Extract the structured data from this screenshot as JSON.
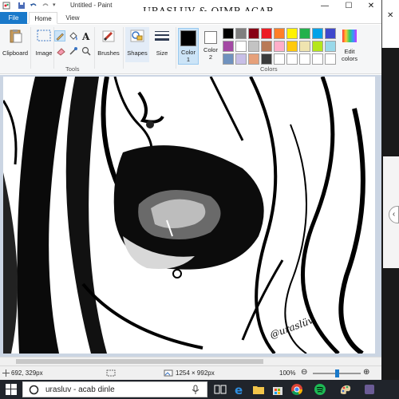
{
  "window": {
    "title": "Untitled - Paint",
    "overlay_caption": "URASLUV & QIMP ACAB",
    "controls": {
      "minimize": "—",
      "maximize": "☐",
      "close": "✕"
    }
  },
  "tabs": {
    "file": "File",
    "home": "Home",
    "view": "View"
  },
  "ribbon": {
    "clipboard": "Clipboard",
    "image": "Image",
    "tools": "Tools",
    "brushes": "Brushes",
    "shapes": "Shapes",
    "size": "Size",
    "color1": "Color\n1",
    "color1_a": "Color",
    "color1_b": "1",
    "color2_a": "Color",
    "color2_b": "2",
    "colors": "Colors",
    "edit_colors_a": "Edit",
    "edit_colors_b": "colors"
  },
  "palette": [
    "#000000",
    "#7f7f7f",
    "#880015",
    "#ed1c24",
    "#ff7f27",
    "#fff200",
    "#22b14c",
    "#00a2e8",
    "#3f48cc",
    "#a349a4",
    "#ffffff",
    "#c3c3c3",
    "#b97a57",
    "#ffaec9",
    "#ffc90e",
    "#efe4b0",
    "#b5e61d",
    "#99d9ea",
    "#7092be",
    "#c8bfe7",
    "#e6a07a",
    "#3b3b3b",
    "#ffffff",
    "#ffffff",
    "#ffffff",
    "#ffffff",
    "#ffffff",
    "#ffffff",
    "#ffffff",
    "#ffffff"
  ],
  "color1_value": "#000000",
  "color2_value": "#ffffff",
  "accent": "#1979ca",
  "artwork_signature": "@uraslüv",
  "status": {
    "cursor_pos": "692, 329px",
    "image_size": "1254 × 992px",
    "zoom": "100%",
    "zoom_level": 0.5
  },
  "taskbar": {
    "search_text": "urasluv - acab dinle"
  },
  "icons": [
    "save-icon",
    "undo-icon",
    "redo-icon",
    "clipboard-icon",
    "image-select-icon",
    "pencil-icon",
    "fill-icon",
    "text-icon",
    "eraser-icon",
    "picker-icon",
    "magnifier-icon",
    "brush-icon",
    "shapes-icon",
    "size-icon",
    "edit-colors-icon",
    "windows-start-icon",
    "search-icon",
    "microphone-icon",
    "task-view-icon",
    "edge-icon",
    "explorer-icon",
    "store-icon",
    "chrome-icon",
    "spotify-icon",
    "paint-icon",
    "zoom-out-icon",
    "zoom-in-icon",
    "cursor-pos-icon",
    "selection-size-icon",
    "image-size-icon"
  ]
}
